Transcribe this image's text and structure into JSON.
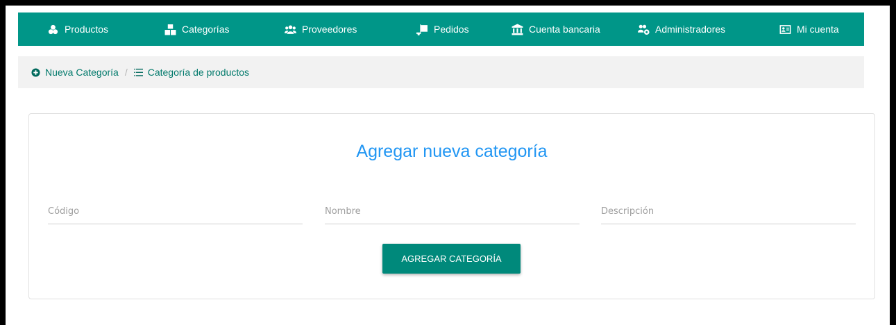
{
  "nav": {
    "items": [
      {
        "label": "Productos",
        "icon": "cubes-icon"
      },
      {
        "label": "Categorías",
        "icon": "boxes-icon"
      },
      {
        "label": "Proveedores",
        "icon": "users-icon"
      },
      {
        "label": "Pedidos",
        "icon": "dolly-icon"
      },
      {
        "label": "Cuenta bancaria",
        "icon": "bank-icon"
      },
      {
        "label": "Administradores",
        "icon": "users-cog-icon"
      },
      {
        "label": "Mi cuenta",
        "icon": "id-card-icon"
      }
    ]
  },
  "breadcrumb": {
    "items": [
      {
        "label": "Nueva Categoría",
        "icon": "plus-circle-icon"
      },
      {
        "label": "Categoría de productos",
        "icon": "list-icon"
      }
    ],
    "separator": "/"
  },
  "form": {
    "title": "Agregar nueva categoría",
    "fields": {
      "codigo": {
        "placeholder": "Código",
        "value": ""
      },
      "nombre": {
        "placeholder": "Nombre",
        "value": ""
      },
      "descripcion": {
        "placeholder": "Descripción",
        "value": ""
      }
    },
    "submit_label": "AGREGAR CATEGORÍA"
  },
  "colors": {
    "primary": "#009688",
    "button": "#00897b",
    "title": "#2196f3",
    "breadcrumb_link": "#00796b"
  }
}
